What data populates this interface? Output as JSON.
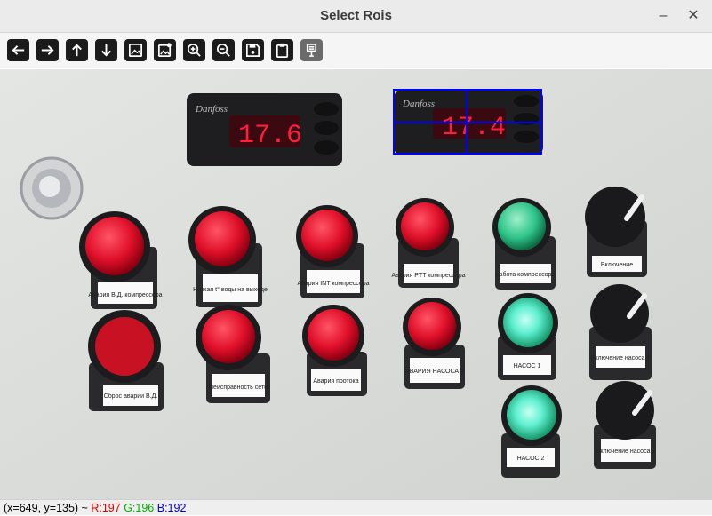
{
  "window": {
    "title": "Select Rois",
    "minimize_glyph": "–",
    "close_glyph": "✕"
  },
  "toolbar": {
    "tools": [
      {
        "name": "arrow-left-icon"
      },
      {
        "name": "arrow-right-icon"
      },
      {
        "name": "arrow-up-icon"
      },
      {
        "name": "arrow-down-icon"
      },
      {
        "name": "image-icon"
      },
      {
        "name": "image-settings-icon"
      },
      {
        "name": "zoom-in-icon"
      },
      {
        "name": "zoom-out-icon"
      },
      {
        "name": "save-icon"
      },
      {
        "name": "clipboard-icon"
      },
      {
        "name": "properties-icon"
      }
    ]
  },
  "image": {
    "controllers": [
      {
        "brand": "Danfoss",
        "reading": "17.6"
      },
      {
        "brand": "Danfoss",
        "reading": "17.4"
      }
    ],
    "panel_labels": [
      "Авария В.Д. компрессора",
      "Низкая t° воды на выходе",
      "Авария INT компрессора",
      "Авария PTT компрессора",
      "работа компрессора",
      "Включение",
      "Сброс аварии В.Д.",
      "Неисправность сети",
      "Авария протока",
      "АВАРИЯ НАСОСА 1",
      "НАСОС 1",
      "Включение насоса 1",
      "НАСОС 2",
      "Включение насоса 2"
    ],
    "roi_color": "#0000ff"
  },
  "status": {
    "coords": "(x=649, y=135) ~",
    "r": "R:197",
    "g": "G:196",
    "b": "B:192",
    "r_color": "#e00000",
    "g_color": "#00b000",
    "b_color": "#0000e0"
  }
}
